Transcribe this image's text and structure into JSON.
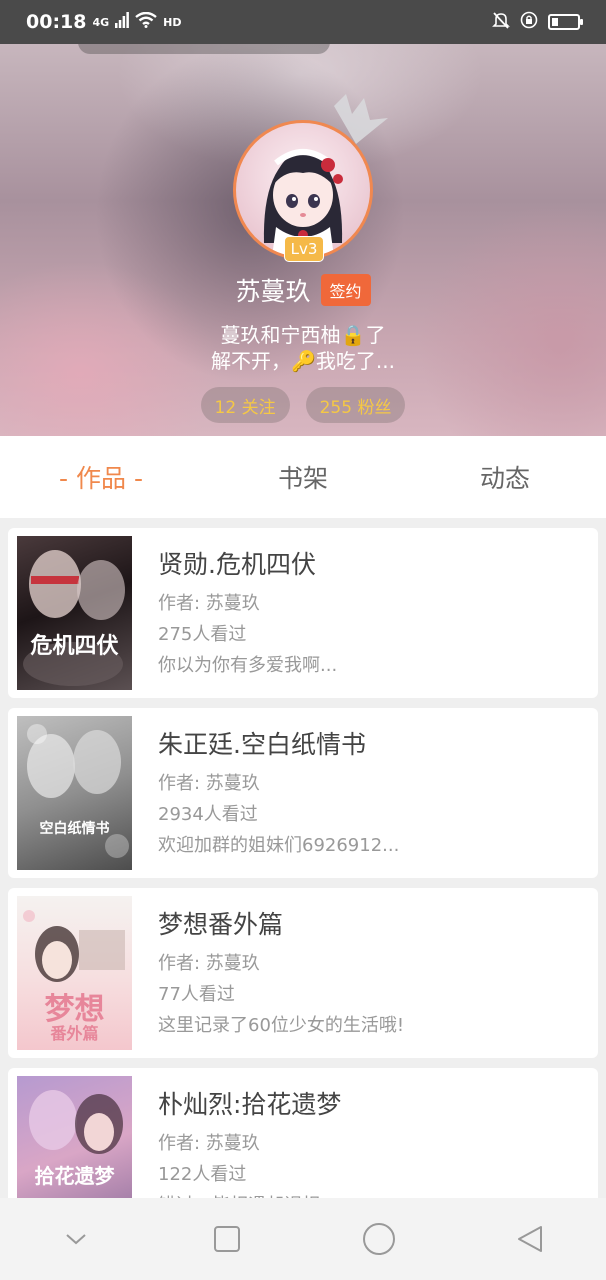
{
  "status_bar": {
    "time": "00:18",
    "network": "4G",
    "hd": "HD",
    "battery_level": 0.22
  },
  "profile": {
    "name": "苏蔓玖",
    "level": "Lv3",
    "signed_label": "签约",
    "bio_line1": "蔓玖和宁西柚🔒了",
    "bio_line2": "解不开，🔑我吃了...",
    "following": "12 关注",
    "followers": "255 粉丝"
  },
  "tabs": [
    {
      "label": "- 作品 -",
      "active": true
    },
    {
      "label": "书架",
      "active": false
    },
    {
      "label": "动态",
      "active": false
    }
  ],
  "books": [
    {
      "title": "贤勋.危机四伏",
      "author": "作者: 苏蔓玖",
      "views": "275人看过",
      "intro": "你以为你有多爱我啊...",
      "cover_text": "危机四伏"
    },
    {
      "title": "朱正廷.空白纸情书",
      "author": "作者: 苏蔓玖",
      "views": "2934人看过",
      "intro": "欢迎加群的姐妹们6926912...",
      "cover_text": "空白纸情书"
    },
    {
      "title": "梦想番外篇",
      "author": "作者: 苏蔓玖",
      "views": "77人看过",
      "intro": "这里记录了60位少女的生活哦!",
      "cover_text": "梦想",
      "cover_subtext": "番外篇"
    },
    {
      "title": "朴灿烈:拾花遗梦",
      "author": "作者: 苏蔓玖",
      "views": "122人看过",
      "intro": "错过，皆相遇却误相",
      "cover_text": "拾花遗梦"
    }
  ],
  "colors": {
    "accent": "#f0884c",
    "signed": "#f0683a",
    "level_badge": "#f5b948",
    "stat_text": "#f5c845"
  },
  "nav_icons": [
    "chevron-down-icon",
    "recents-square-icon",
    "home-circle-icon",
    "back-triangle-icon"
  ]
}
